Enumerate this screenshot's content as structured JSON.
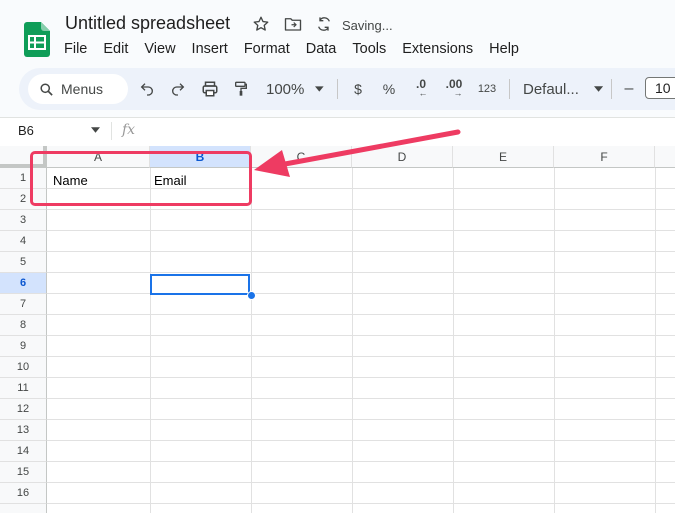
{
  "header": {
    "doc_title": "Untitled spreadsheet",
    "status": "Saving...",
    "icons": [
      "sheets-logo-icon",
      "star-icon",
      "move-to-folder-icon",
      "sync-icon"
    ]
  },
  "menubar": [
    "File",
    "Edit",
    "View",
    "Insert",
    "Format",
    "Data",
    "Tools",
    "Extensions",
    "Help"
  ],
  "toolbar": {
    "search_label": "Menus",
    "zoom": "100%",
    "currency": "$",
    "percent": "%",
    "decrease_decimal": ".0",
    "increase_decimal": ".00",
    "number_format": "123",
    "font": "Defaul...",
    "font_size": "10",
    "minus": "–"
  },
  "formula_bar": {
    "name_box": "B6",
    "fx": "fx"
  },
  "grid": {
    "columns": [
      "A",
      "B",
      "C",
      "D",
      "E",
      "F"
    ],
    "selected_column": "B",
    "rows": [
      "1",
      "2",
      "3",
      "4",
      "5",
      "6",
      "7",
      "8",
      "9",
      "10",
      "11",
      "12",
      "13",
      "14",
      "15",
      "16"
    ],
    "selected_row": "6",
    "cells": {
      "A1": "Name",
      "B1": "Email"
    }
  },
  "annotation": {
    "color": "#ee3b62"
  }
}
